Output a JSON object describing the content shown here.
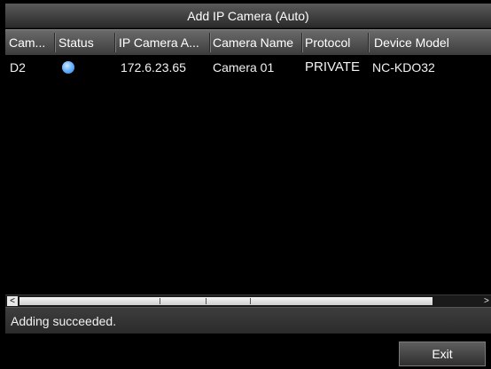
{
  "dialog": {
    "title": "Add IP Camera (Auto)"
  },
  "table": {
    "columns": [
      "Cam...",
      "Status",
      "IP Camera A...",
      "Camera Name",
      "Protocol",
      "Device Model"
    ],
    "rows": [
      {
        "camera": "D2",
        "status": "online",
        "status_color": "#4aa3ff",
        "ip": "172.6.23.65",
        "name": "Camera 01",
        "protocol": "PRIVATE",
        "model": "NC-KDO32"
      }
    ]
  },
  "scrollbar": {
    "left_arrow": "<",
    "right_arrow": ">"
  },
  "status_message": "Adding succeeded.",
  "footer": {
    "exit_label": "Exit"
  }
}
